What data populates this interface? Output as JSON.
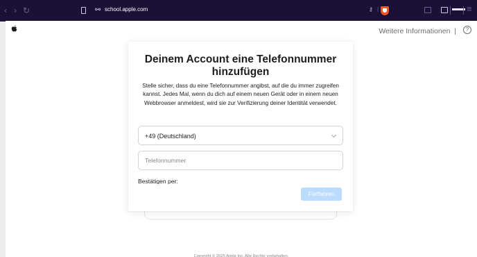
{
  "browser": {
    "nav": {
      "back": "‹",
      "forward": "›",
      "reload": "↻"
    },
    "url": "school.apple.com",
    "icons": [
      "bookmark-icon",
      "site-settings-icon",
      "key-icon",
      "brave-shield-icon",
      "sidebar-icon",
      "wallet-icon",
      "private-mask-icon",
      "menu-icon"
    ],
    "accent": "#1b1035"
  },
  "header": {
    "more_info": "Weitere Informationen",
    "separator": "|",
    "help": "?"
  },
  "card": {
    "title": "Deinem Account eine Telefonnummer hinzufügen",
    "description": "Stelle sicher, dass du eine Telefonnummer angibst, auf die du immer zugreifen kannst. Jedes Mal, wenn du dich auf einem neuen Gerät oder in einem neuen Webbrowser anmeldest, wird sie zur Verifizierung deiner Identität verwendet.",
    "country": "+49 (Deutschland)",
    "phone_value": "",
    "phone_placeholder": "Telefonnummer",
    "confirm_label": "Bestätigen per:",
    "continue_label": "Fortfahren",
    "continue_color": "#bcdcff"
  },
  "footer": {
    "copyright": "Copyright © 2025 Apple Inc. Alle Rechte vorbehalten."
  }
}
